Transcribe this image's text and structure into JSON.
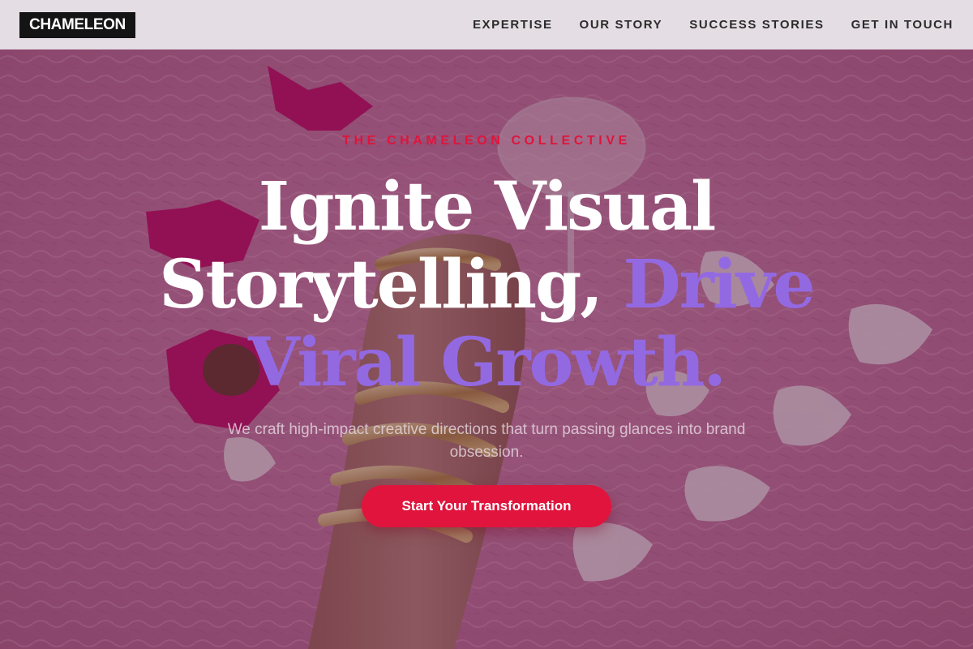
{
  "header": {
    "logo": "CHAMELEON",
    "nav": [
      {
        "label": "EXPERTISE"
      },
      {
        "label": "OUR STORY"
      },
      {
        "label": "SUCCESS STORIES"
      },
      {
        "label": "GET IN TOUCH"
      }
    ]
  },
  "hero": {
    "eyebrow": "THE CHAMELEON COLLECTIVE",
    "headline_part1": "Ignite Visual Storytelling, ",
    "headline_accent": "Drive Viral Growth.",
    "subtext": "We craft high-impact creative directions that turn passing glances into brand obsession.",
    "cta_label": "Start Your Transformation",
    "background_description_icon": "hero-photo",
    "colors": {
      "accent": "#9369e2",
      "cta": "#e0143c",
      "eyebrow": "#e0143c"
    }
  }
}
